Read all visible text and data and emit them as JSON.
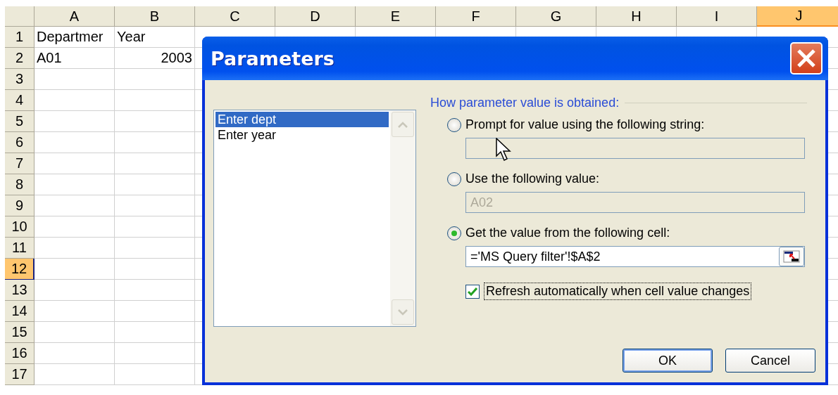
{
  "sheet": {
    "columns": [
      {
        "label": "A",
        "selected": false
      },
      {
        "label": "B",
        "selected": false
      },
      {
        "label": "C",
        "selected": false
      },
      {
        "label": "D",
        "selected": false
      },
      {
        "label": "E",
        "selected": false
      },
      {
        "label": "F",
        "selected": false
      },
      {
        "label": "G",
        "selected": false
      },
      {
        "label": "H",
        "selected": false
      },
      {
        "label": "I",
        "selected": false
      },
      {
        "label": "J",
        "selected": true
      }
    ],
    "rows": [
      {
        "label": "1",
        "selected": false,
        "cells": [
          {
            "text": "Departmer",
            "kind": "text"
          },
          {
            "text": "Year",
            "kind": "text"
          }
        ]
      },
      {
        "label": "2",
        "selected": false,
        "cells": [
          {
            "text": "A01",
            "kind": "text"
          },
          {
            "text": "2003",
            "kind": "number"
          }
        ]
      },
      {
        "label": "3",
        "selected": false
      },
      {
        "label": "4",
        "selected": false
      },
      {
        "label": "5",
        "selected": false
      },
      {
        "label": "6",
        "selected": false
      },
      {
        "label": "7",
        "selected": false
      },
      {
        "label": "8",
        "selected": false
      },
      {
        "label": "9",
        "selected": false
      },
      {
        "label": "10",
        "selected": false
      },
      {
        "label": "11",
        "selected": false
      },
      {
        "label": "12",
        "selected": true
      },
      {
        "label": "13",
        "selected": false
      },
      {
        "label": "14",
        "selected": false
      },
      {
        "label": "15",
        "selected": false
      },
      {
        "label": "16",
        "selected": false
      },
      {
        "label": "17",
        "selected": false
      }
    ]
  },
  "dialog": {
    "title": "Parameters",
    "parameters": [
      {
        "label": "Enter dept",
        "selected": true
      },
      {
        "label": "Enter year",
        "selected": false
      }
    ],
    "group_label": "How parameter value is obtained:",
    "options": [
      {
        "label": "Prompt for value using the following string:",
        "selected": false,
        "field": {
          "kind": "text",
          "disabled": true
        }
      },
      {
        "label": "Use the following value:",
        "selected": false,
        "field": {
          "kind": "text",
          "value": "A02",
          "disabled": true
        }
      },
      {
        "label": "Get the value from the following cell:",
        "selected": true,
        "field": {
          "kind": "cell-ref",
          "value": "='MS Query filter'!$A$2",
          "disabled": false
        }
      }
    ],
    "refresh": {
      "label": "Refresh automatically when cell value changes",
      "checked": true
    },
    "buttons": [
      {
        "label": "OK",
        "default": true
      },
      {
        "label": "Cancel",
        "default": false
      }
    ]
  }
}
